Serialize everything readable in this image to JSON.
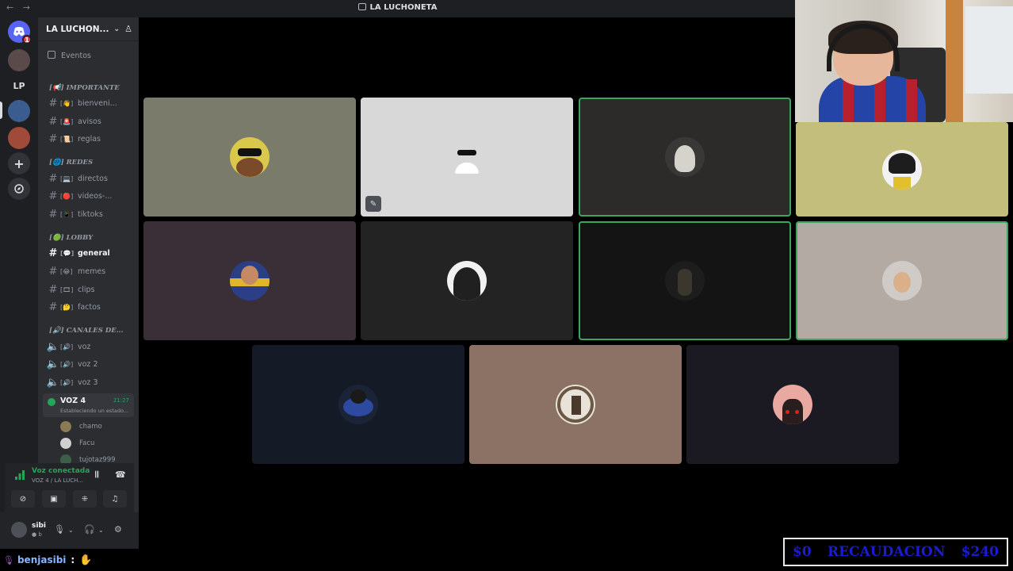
{
  "window": {
    "title": "LA LUCHONETA",
    "nav_arrows": "← →"
  },
  "rail": {
    "badge_count": "1",
    "server_initials": "LP"
  },
  "sidebar": {
    "server_name": "LA LUCHON...",
    "events_label": "Eventos",
    "categories": {
      "importante": "[📢] IMPORTANTE",
      "redes": "[🌐] REDES",
      "lobby": "[🟢] LOBBY",
      "voz": "[🔊] CANALES DE..."
    },
    "channels": {
      "bienvenida": "bienveni...",
      "avisos": "avisos",
      "reglas": "reglas",
      "directos": "directos",
      "videos": "videos-...",
      "tiktoks": "tiktoks",
      "general": "general",
      "memes": "memes",
      "clips": "clips",
      "factos": "factos"
    },
    "voice_channels": {
      "voz": "voz",
      "voz2": "voz 2",
      "voz3": "voz 3"
    },
    "active_voice": {
      "name": "VOZ 4",
      "time": "21:27",
      "subtitle": "Estableciendo un estado..."
    },
    "voice_users": [
      "chamo",
      "Facu",
      "tujotaz999"
    ]
  },
  "connection": {
    "status": "Voz conectada",
    "channel": "VOZ 4 / LA LUCH..."
  },
  "user": {
    "name": "sibi",
    "status": "● b"
  },
  "chat": {
    "username": "benjasibi",
    "colon": ":"
  },
  "ticker": {
    "left": "$0",
    "label": "RECAUDACION",
    "right": "$240"
  },
  "tiles_colors": {
    "gray": "#7b7b6b",
    "light": "#d8d8d8",
    "dark": "#2c2b29",
    "olive": "#c4be7c",
    "plum": "#3a2f36",
    "charcoal": "#242323",
    "black": "#141414",
    "taupe": "#b3aaa4",
    "navy": "#141a26",
    "brown": "#8c7264",
    "indigo": "#1b1a23"
  }
}
